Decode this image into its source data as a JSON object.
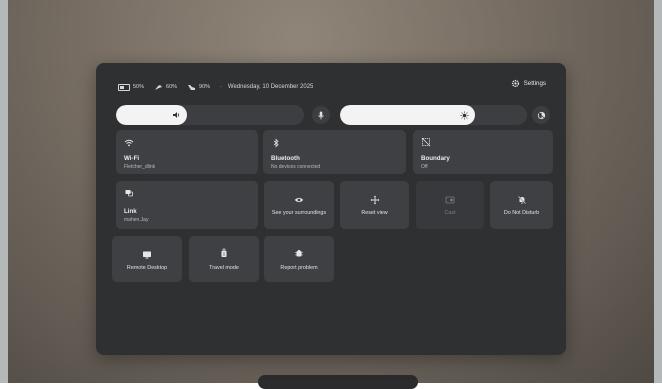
{
  "status": {
    "battery": "50%",
    "controller": "60%",
    "controller2": "90%",
    "separator": "·",
    "date": "Wednesday, 10 December 2025"
  },
  "settings_label": "Settings",
  "volume": {
    "level": 0.38
  },
  "brightness": {
    "level": 0.72
  },
  "tiles": {
    "wifi": {
      "label": "Wi-Fi",
      "sub": "Fletcher_dlink"
    },
    "bluetooth": {
      "label": "Bluetooth",
      "sub": "No devices connected"
    },
    "boundary": {
      "label": "Boundary",
      "sub": "Off"
    },
    "link": {
      "label": "Link",
      "sub": "mahen.Jay"
    },
    "surroundings": {
      "label": "See your surroundings"
    },
    "reset_view": {
      "label": "Reset view"
    },
    "cast": {
      "label": "Cast"
    },
    "dnd": {
      "label": "Do Not Disturb"
    },
    "remote_desktop": {
      "label": "Remote Desktop"
    },
    "travel_mode": {
      "label": "Travel mode"
    },
    "report_problem": {
      "label": "Report problem"
    }
  }
}
